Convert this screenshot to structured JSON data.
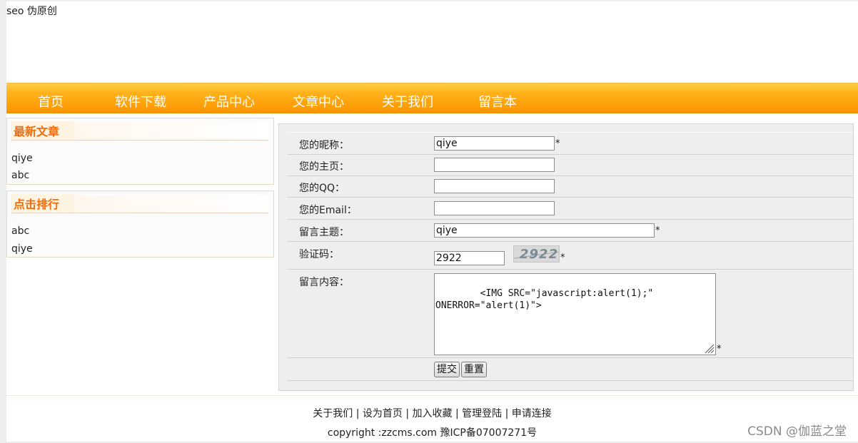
{
  "site": {
    "title": "seo 伪原创"
  },
  "nav": {
    "items": [
      "首页",
      "软件下载",
      "产品中心",
      "文章中心",
      "关于我们",
      "留言本"
    ]
  },
  "sidebar": {
    "latest": {
      "title": "最新文章",
      "items": [
        "qiye",
        "abc"
      ]
    },
    "ranking": {
      "title": "点击排行",
      "items": [
        "abc",
        "qiye"
      ]
    }
  },
  "form": {
    "nickname": {
      "label": "您的昵称：",
      "value": "qiye"
    },
    "homepage": {
      "label": "您的主页：",
      "value": ""
    },
    "qq": {
      "label": "您的QQ：",
      "value": ""
    },
    "email": {
      "label": "您的Email：",
      "value": ""
    },
    "subject": {
      "label": "留言主题：",
      "value": "qiye"
    },
    "captcha": {
      "label": "验证码：",
      "value": "2922",
      "image_text": "2922"
    },
    "content": {
      "label": "留言内容：",
      "value": "<IMG SRC=\"javascript:alert(1);\"\nONERROR=\"alert(1)\">"
    },
    "required_mark": "*",
    "submit_label": "提交",
    "reset_label": "重置"
  },
  "footer": {
    "links": [
      "关于我们",
      "设为首页",
      "加入收藏",
      "管理登陆",
      "申请连接"
    ],
    "separator": " | ",
    "copyright": "copyright :zzcms.com  豫ICP备07007271号"
  },
  "watermark": "CSDN @伽蓝之堂",
  "colors": {
    "nav_orange": "#ffa50f",
    "box_title": "#f06c0c"
  }
}
